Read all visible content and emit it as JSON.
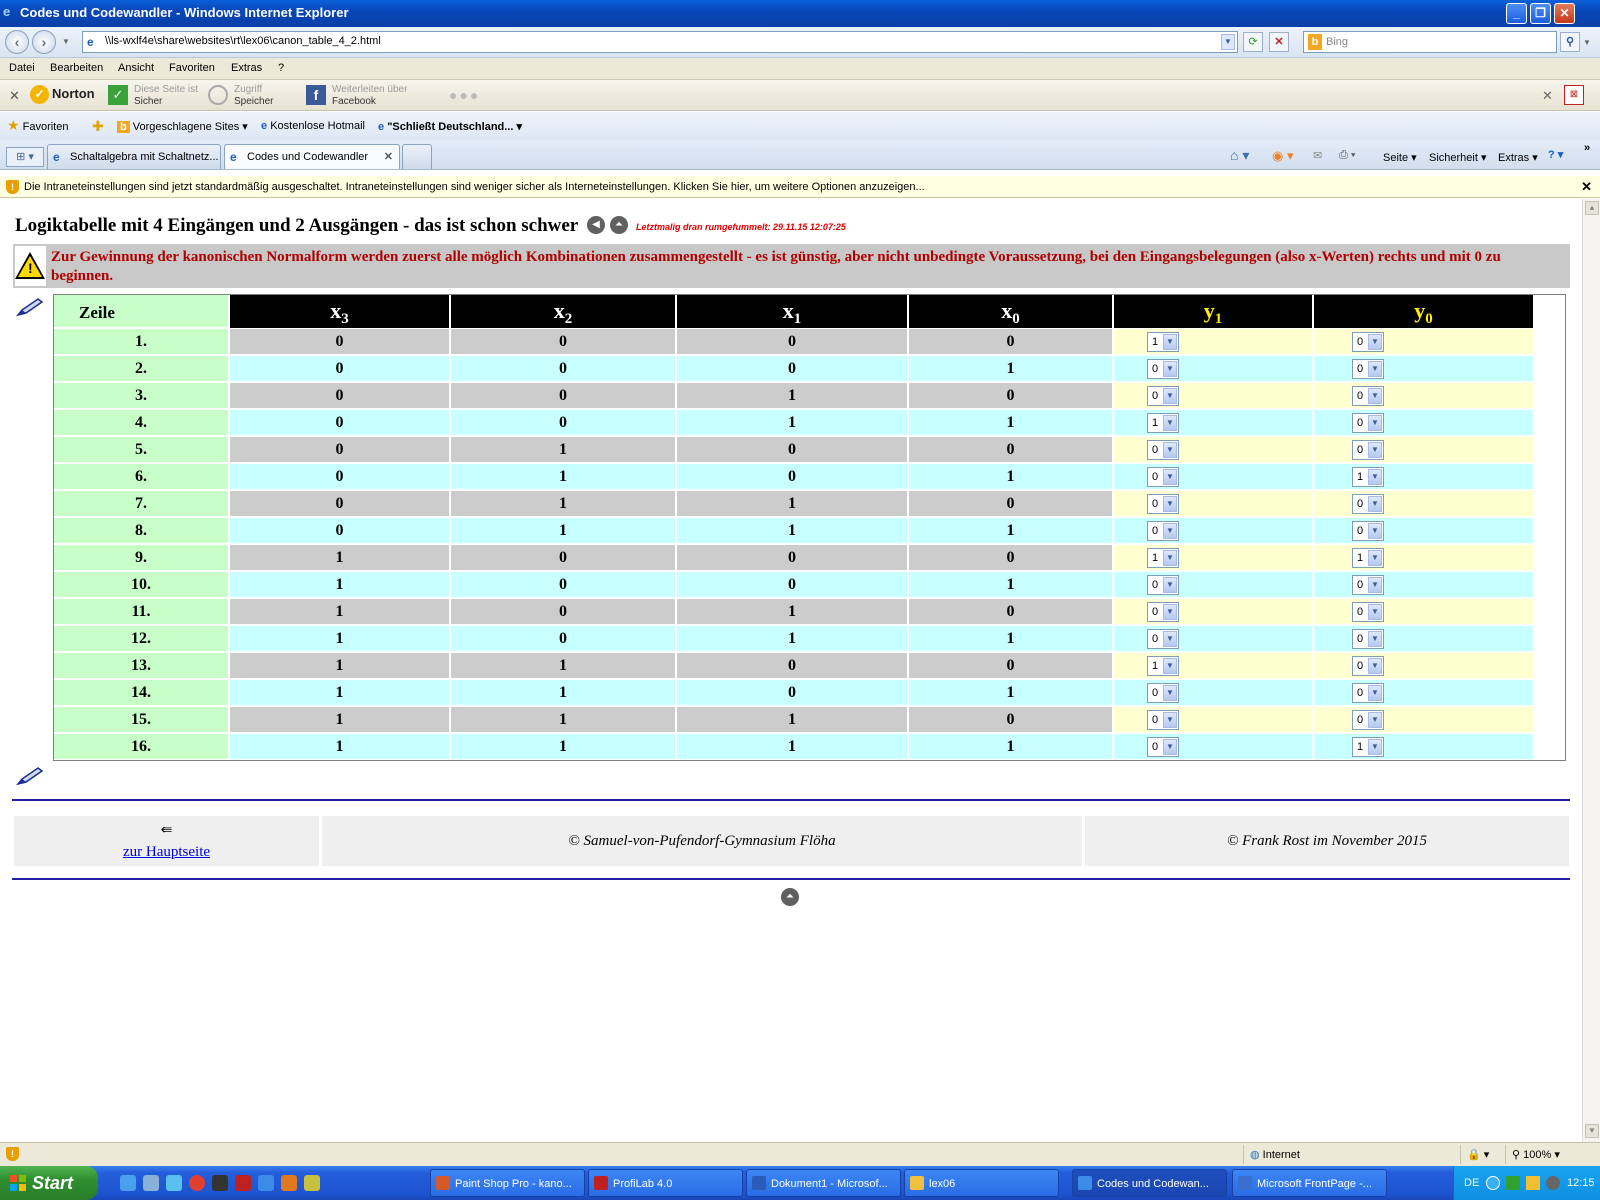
{
  "window": {
    "title": "Codes und Codewandler - Windows Internet Explorer"
  },
  "address_bar": {
    "url": "\\\\ls-wxlf4e\\share\\websites\\rt\\lex06\\canon_table_4_2.html",
    "search_placeholder": "Bing"
  },
  "menu": [
    "Datei",
    "Bearbeiten",
    "Ansicht",
    "Favoriten",
    "Extras",
    "?"
  ],
  "norton_toolbar": {
    "logo": "Norton",
    "items": [
      {
        "line1": "Diese Seite ist",
        "line2": "Sicher"
      },
      {
        "line1": "Zugriff",
        "line2": "Speicher"
      },
      {
        "line1": "Weiterleiten über",
        "line2": "Facebook"
      }
    ]
  },
  "favorites_bar": {
    "favorites_label": "Favoriten",
    "items": [
      "Vorgeschlagene Sites",
      "Kostenlose Hotmail",
      "\"Schließt Deutschland..."
    ]
  },
  "tabs": [
    {
      "label": "Schaltalgebra mit Schaltnetz..."
    },
    {
      "label": "Codes und Codewandler"
    }
  ],
  "commandbar": {
    "page": "Seite",
    "security": "Sicherheit",
    "tools": "Extras"
  },
  "info_bar": {
    "text": "Die Intraneteinstellungen sind jetzt standardmäßig ausgeschaltet. Intraneteinstellungen sind weniger sicher als Interneteinstellungen. Klicken Sie hier, um weitere Optionen anzuzeigen..."
  },
  "page": {
    "heading": "Logiktabelle mit 4 Eingängen und 2 Ausgängen - das ist schon schwer",
    "last_modified": "Letztmalig dran rumgefummelt: 29.11.15 12:07:25",
    "warning": "Zur Gewinnung der kanonischen Normalform werden zuerst alle möglich Kombinationen zusammengestellt - es ist günstig, aber nicht unbedingte Voraussetzung, bei den Eingangsbelegungen (also x-Werten) rechts und mit 0 zu beginnen.",
    "table": {
      "headers": {
        "zeile": "Zeile",
        "x3": {
          "base": "x",
          "sub": "3"
        },
        "x2": {
          "base": "x",
          "sub": "2"
        },
        "x1": {
          "base": "x",
          "sub": "1"
        },
        "x0": {
          "base": "x",
          "sub": "0"
        },
        "y1": {
          "base": "y",
          "sub": "1"
        },
        "y0": {
          "base": "y",
          "sub": "0"
        }
      },
      "rows": [
        {
          "zeile": "1.",
          "x3": "0",
          "x2": "0",
          "x1": "0",
          "x0": "0",
          "y1": "1",
          "y0": "0"
        },
        {
          "zeile": "2.",
          "x3": "0",
          "x2": "0",
          "x1": "0",
          "x0": "1",
          "y1": "0",
          "y0": "0"
        },
        {
          "zeile": "3.",
          "x3": "0",
          "x2": "0",
          "x1": "1",
          "x0": "0",
          "y1": "0",
          "y0": "0"
        },
        {
          "zeile": "4.",
          "x3": "0",
          "x2": "0",
          "x1": "1",
          "x0": "1",
          "y1": "1",
          "y0": "0"
        },
        {
          "zeile": "5.",
          "x3": "0",
          "x2": "1",
          "x1": "0",
          "x0": "0",
          "y1": "0",
          "y0": "0"
        },
        {
          "zeile": "6.",
          "x3": "0",
          "x2": "1",
          "x1": "0",
          "x0": "1",
          "y1": "0",
          "y0": "1"
        },
        {
          "zeile": "7.",
          "x3": "0",
          "x2": "1",
          "x1": "1",
          "x0": "0",
          "y1": "0",
          "y0": "0"
        },
        {
          "zeile": "8.",
          "x3": "0",
          "x2": "1",
          "x1": "1",
          "x0": "1",
          "y1": "0",
          "y0": "0"
        },
        {
          "zeile": "9.",
          "x3": "1",
          "x2": "0",
          "x1": "0",
          "x0": "0",
          "y1": "1",
          "y0": "1"
        },
        {
          "zeile": "10.",
          "x3": "1",
          "x2": "0",
          "x1": "0",
          "x0": "1",
          "y1": "0",
          "y0": "0"
        },
        {
          "zeile": "11.",
          "x3": "1",
          "x2": "0",
          "x1": "1",
          "x0": "0",
          "y1": "0",
          "y0": "0"
        },
        {
          "zeile": "12.",
          "x3": "1",
          "x2": "0",
          "x1": "1",
          "x0": "1",
          "y1": "0",
          "y0": "0"
        },
        {
          "zeile": "13.",
          "x3": "1",
          "x2": "1",
          "x1": "0",
          "x0": "0",
          "y1": "1",
          "y0": "0"
        },
        {
          "zeile": "14.",
          "x3": "1",
          "x2": "1",
          "x1": "0",
          "x0": "1",
          "y1": "0",
          "y0": "0"
        },
        {
          "zeile": "15.",
          "x3": "1",
          "x2": "1",
          "x1": "1",
          "x0": "0",
          "y1": "0",
          "y0": "0"
        },
        {
          "zeile": "16.",
          "x3": "1",
          "x2": "1",
          "x1": "1",
          "x0": "1",
          "y1": "0",
          "y0": "1"
        }
      ]
    },
    "footer": {
      "home_link": "zur Hauptseite",
      "school": "© Samuel-von-Pufendorf-Gymnasium Flöha",
      "author": "© Frank Rost im November 2015"
    }
  },
  "status_bar": {
    "zone": "Internet",
    "zoom": "100%"
  },
  "taskbar": {
    "start": "Start",
    "buttons": [
      {
        "label": "Paint Shop Pro - kano...",
        "color": "#d45a2a"
      },
      {
        "label": "ProfiLab 4.0",
        "color": "#c02020"
      },
      {
        "label": "Dokument1 - Microsof...",
        "color": "#2b5cb8"
      },
      {
        "label": "lex06",
        "color": "#f0c040"
      },
      {
        "label": "Codes und Codewan...",
        "color": "#3a8ce8"
      },
      {
        "label": "Microsoft FrontPage -...",
        "color": "#3a6fd0"
      }
    ],
    "tray": {
      "lang": "DE",
      "time": "12:15"
    }
  },
  "colors": {
    "zeile_bg": "#c8ffc8",
    "row_gray": "#cccccc",
    "row_cyan": "#c8ffff",
    "output_bg": "#ffffd0",
    "warning_text": "#b00000",
    "y_header_text": "#ffee00"
  }
}
